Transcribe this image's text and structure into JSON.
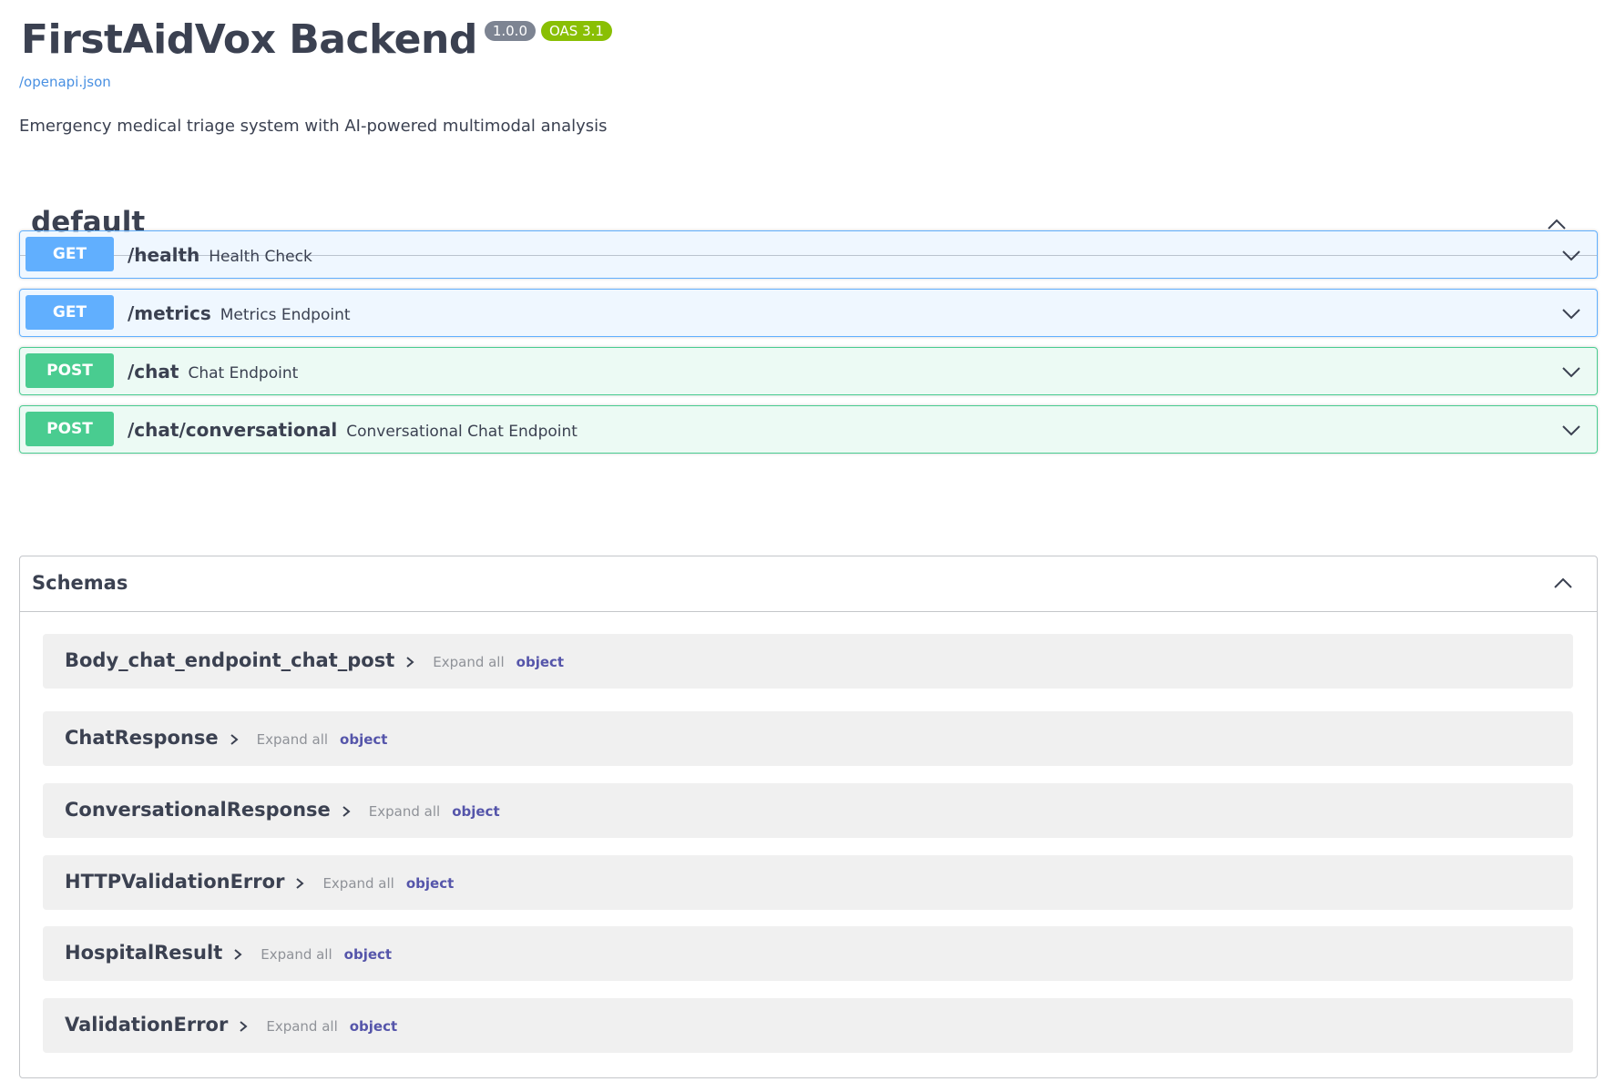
{
  "info": {
    "title": "FirstAidVox Backend",
    "version": "1.0.0",
    "oas": "OAS 3.1",
    "spec_link": "/openapi.json",
    "description": "Emergency medical triage system with AI-powered multimodal analysis"
  },
  "tag": {
    "name": "default",
    "toggle_icon": "chevron-up-icon"
  },
  "operations": [
    {
      "method": "GET",
      "path": "/health",
      "summary": "Health Check"
    },
    {
      "method": "GET",
      "path": "/metrics",
      "summary": "Metrics Endpoint"
    },
    {
      "method": "POST",
      "path": "/chat",
      "summary": "Chat Endpoint"
    },
    {
      "method": "POST",
      "path": "/chat/conversational",
      "summary": "Conversational Chat Endpoint"
    }
  ],
  "schemas": {
    "title": "Schemas",
    "expand_label": "Expand all",
    "items": [
      {
        "name": "Body_chat_endpoint_chat_post",
        "type": "object"
      },
      {
        "name": "ChatResponse",
        "type": "object"
      },
      {
        "name": "ConversationalResponse",
        "type": "object"
      },
      {
        "name": "HTTPValidationError",
        "type": "object"
      },
      {
        "name": "HospitalResult",
        "type": "object"
      },
      {
        "name": "ValidationError",
        "type": "object"
      }
    ]
  },
  "colors": {
    "get": "#61affe",
    "post": "#49cc90",
    "version_badge": "#7d8492",
    "oas_badge": "#89bf04",
    "link": "#4990e2",
    "model_type": "#55a"
  }
}
